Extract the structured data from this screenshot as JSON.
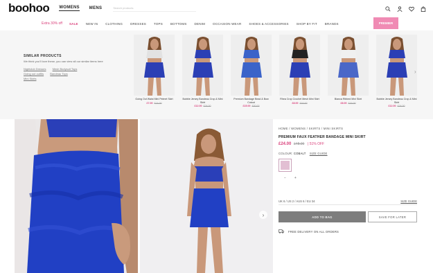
{
  "header": {
    "logo": "boohoo",
    "tabs": [
      {
        "label": "WOMENS",
        "active": true
      },
      {
        "label": "MENS",
        "active": false
      }
    ],
    "search_placeholder": "Search products",
    "icons": [
      "search-icon",
      "account-icon",
      "wishlist-icon",
      "bag-icon"
    ]
  },
  "nav": {
    "promo": "Extra 30% off",
    "items": [
      "SALE",
      "NEW IN",
      "CLOTHING",
      "DRESSES",
      "TOPS",
      "BOTTOMS",
      "DENIM",
      "OCCASION WEAR",
      "SHOES & ACCESSORIES",
      "SHOP BY FIT",
      "BRANDS"
    ],
    "cta": "PREMIER"
  },
  "similar": {
    "title": "SIMILAR PRODUCTS",
    "description": "We think you'll love these, you can view all our similar items here",
    "links": [
      "Nightclub Dresses",
      "Mesh Bodysuit Tops",
      "Going out outfits",
      "Bandeau Tops",
      "Mini Skirts"
    ],
    "products": [
      {
        "name": "Going Out Waist Mini Pelmet Skirt",
        "price": "£7.00",
        "was": "£14.00",
        "color": "#2b3fb5",
        "top": "#e2e2e2"
      },
      {
        "name": "Bubble Jersey Bandeau Crop & Mini Skirt",
        "price": "£12.00",
        "was": "£24.00",
        "color": "#2b3fb5",
        "top": "#2b3fb5"
      },
      {
        "name": "Premium Bandage Bead & Bow Cutout",
        "price": "£15.00",
        "was": "£30.00",
        "color": "#3a63c9",
        "top": "#3a63c9"
      },
      {
        "name": "Rhea Crop Crochet Mesh Mini Skirt",
        "price": "£8.00",
        "was": "£16.00",
        "color": "#2b3fb5",
        "top": "#222222"
      },
      {
        "name": "Bianca Ribbed Mini Skirt",
        "price": "£8.00",
        "was": "£16.00",
        "color": "#4a67c8",
        "top": "#f0f0f0"
      },
      {
        "name": "Bubble Jersey Bandeau Crop & Mini Skirt",
        "price": "£12.00",
        "was": "£24.00",
        "color": "#2b3fb5",
        "top": "#2b3fb5"
      }
    ]
  },
  "product": {
    "breadcrumb": "HOME / WOMENS / SKIRTS / MINI SKIRTS",
    "name": "PREMIUM FAUX FEATHER BANDAGE MINI SKIRT",
    "price": "£24.00",
    "was": "£48.00",
    "discount": "| 51% OFF",
    "colour_label": "COLOUR:",
    "colour_value": "COBALT",
    "size_link": "SIZE GUIDE",
    "qty_minus": "−",
    "qty_plus": "+",
    "size_selected": "UK 6 / US 2 / AUS 6 / EU 34",
    "size_guide": "SIZE GUIDE",
    "add_to_bag": "ADD TO BAG",
    "save_for_later": "SAVE FOR LATER",
    "delivery": "FREE DELIVERY ON ALL ORDERS"
  },
  "colors": {
    "accent": "#d93e7a",
    "cobalt": "#2b3fb5",
    "swatch": "#e2bfd3"
  }
}
